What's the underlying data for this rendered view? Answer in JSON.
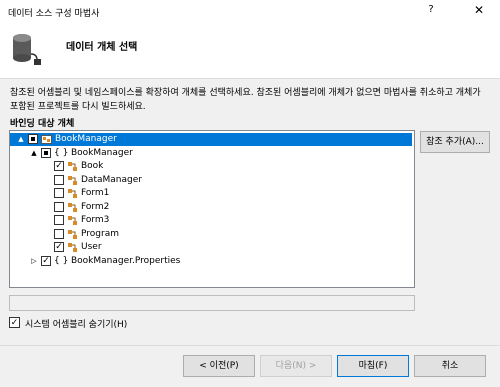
{
  "window": {
    "title": "데이터 소스 구성 마법사",
    "help": "?",
    "close": "✕"
  },
  "header": {
    "title": "데이터 개체 선택",
    "icon": "database-plug-icon"
  },
  "description": "참조된 어셈블리 및 네임스페이스를 확장하여 개체를 선택하세요. 참조된 어셈블리에 개체가 없으면 마법사를 취소하고 개체가 포함된 프로젝트를 다시 빌드하세요.",
  "binding_label": "바인딩 대상 개체",
  "add_reference_button": "참조 추가(A)...",
  "tree": {
    "nodes": [
      {
        "label": "BookManager",
        "icon": "project-icon",
        "checked": "partial",
        "expander": "▲",
        "selected": true
      },
      {
        "label": "BookManager",
        "icon": "namespace-icon",
        "icon_glyph": "{ }",
        "checked": "partial",
        "expander": "▲"
      },
      {
        "label": "Book",
        "icon": "class-icon",
        "checked": "checked"
      },
      {
        "label": "DataManager",
        "icon": "class-icon",
        "checked": "unchecked"
      },
      {
        "label": "Form1",
        "icon": "class-icon",
        "checked": "unchecked"
      },
      {
        "label": "Form2",
        "icon": "class-icon",
        "checked": "unchecked"
      },
      {
        "label": "Form3",
        "icon": "class-icon",
        "checked": "unchecked"
      },
      {
        "label": "Program",
        "icon": "class-icon",
        "checked": "unchecked"
      },
      {
        "label": "User",
        "icon": "class-icon",
        "checked": "checked"
      },
      {
        "label": "BookManager.Properties",
        "icon": "namespace-icon",
        "icon_glyph": "{ }",
        "checked": "checked",
        "expander": "▷"
      }
    ]
  },
  "hide_system_assemblies": {
    "label": "시스템 어셈블리 숨기기(H)",
    "checked": true
  },
  "footer": {
    "prev": "< 이전(P)",
    "next": "다음(N) >",
    "finish": "마침(F)",
    "cancel": "취소"
  },
  "colors": {
    "selection": "#0078d7",
    "class_icon": "#d98a2b",
    "window_bg": "#f0f0f0"
  }
}
